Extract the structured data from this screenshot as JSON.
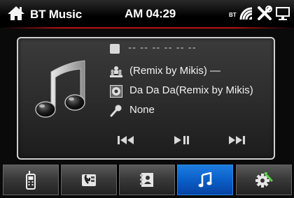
{
  "status_bar": {
    "title": "BT Music",
    "time": "AM 04:29",
    "bt_label": "BT",
    "icons": [
      "home-icon",
      "bluetooth-signal-icon",
      "tools-icon",
      "monitor-icon"
    ]
  },
  "player": {
    "track_number": "-- -- -- -- -- --",
    "artist": "(Remix by Mikis) —",
    "title": "Da Da Da(Remix by Mikis)",
    "album": "None",
    "controls": [
      "previous-track",
      "play-pause",
      "next-track"
    ]
  },
  "tabs": [
    {
      "name": "phone",
      "icon": "phone-icon",
      "active": false
    },
    {
      "name": "contacts",
      "icon": "contacts-transfer-icon",
      "active": false
    },
    {
      "name": "phonebook",
      "icon": "phonebook-icon",
      "active": false
    },
    {
      "name": "music",
      "icon": "music-note-icon",
      "active": true
    },
    {
      "name": "settings",
      "icon": "settings-icon",
      "active": false
    }
  ],
  "colors": {
    "accent_red": "#b31212",
    "active_tab": "#0b5fc8",
    "panel_border": "#cfcfcf"
  }
}
